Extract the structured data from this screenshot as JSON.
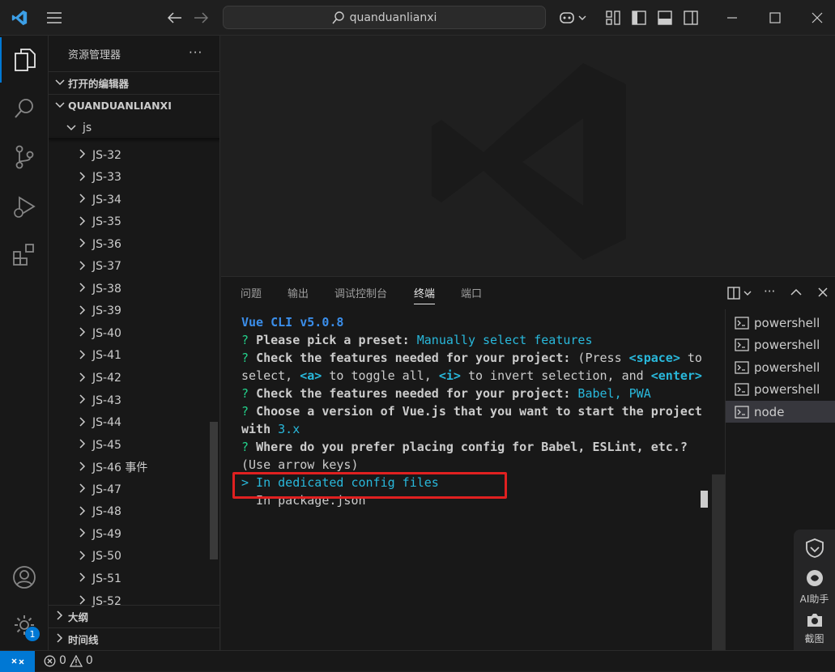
{
  "titlebar": {
    "search_text": "quanduanlianxi"
  },
  "sidebar": {
    "title": "资源管理器",
    "more": "···",
    "open_editors": "打开的编辑器",
    "project": "QUANDUANLIANXI",
    "folder_js": "js",
    "items": [
      "JS-32",
      "JS-33",
      "JS-34",
      "JS-35",
      "JS-36",
      "JS-37",
      "JS-38",
      "JS-39",
      "JS-40",
      "JS-41",
      "JS-42",
      "JS-43",
      "JS-44",
      "JS-45",
      "JS-46 事件",
      "JS-47",
      "JS-48",
      "JS-49",
      "JS-50",
      "JS-51",
      "JS-52"
    ],
    "outline": "大纲",
    "timeline": "时间线"
  },
  "panel": {
    "tabs": [
      "问题",
      "输出",
      "调试控制台",
      "终端",
      "端口"
    ],
    "active_tab": "终端"
  },
  "terminal": {
    "l1": "Vue CLI v5.0.8",
    "l2q": "? ",
    "l2a": "Please pick a preset: ",
    "l2b": "Manually select features",
    "l3a": "Check the features needed for your project: ",
    "l3b": "(Press ",
    "l3c": "<space>",
    "l3d": " to",
    "l4a": "select, ",
    "l4b": "<a>",
    "l4c": " to toggle all, ",
    "l4d": "<i>",
    "l4e": " to invert selection, and ",
    "l4f": "<enter>",
    "l5a": "Check the features needed for your project: ",
    "l5b": "Babel, PWA",
    "l6a": "Choose a version of Vue.js that you want to start the project",
    "l7a": "with ",
    "l7b": "3.x",
    "l8a": "Where do you prefer placing config for Babel, ESLint, etc.?",
    "l9": "(Use arrow keys)",
    "l10": "> In dedicated config files",
    "l11": "  In package.json"
  },
  "termlist": [
    "powershell",
    "powershell",
    "powershell",
    "powershell",
    "node"
  ],
  "status": {
    "errors": "0",
    "warnings": "0"
  },
  "float": {
    "ai": "AI助手",
    "shot": "截图"
  },
  "settings_badge": "1",
  "colors": {
    "accent": "#0078d4",
    "highlight_box": "#e02020"
  }
}
